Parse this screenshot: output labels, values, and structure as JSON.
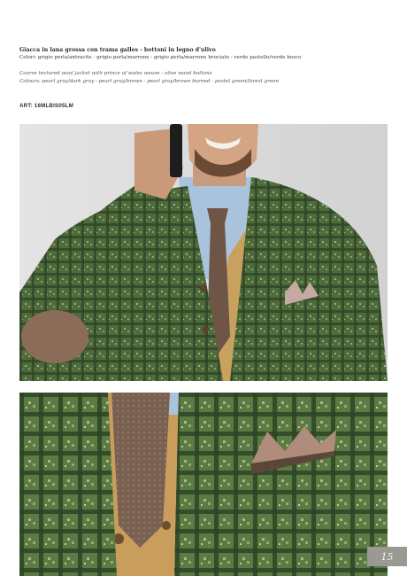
{
  "product": {
    "title_it": "Giacca in lana grossa con trama galles - bottoni in legno d'ulivo",
    "colors_it": "Colori: grigio perla/antracite - grigio perla/marrone - grigio perla/marrone bruciato - verde pastello/verde bosco",
    "title_en": "Coarse textured wool jacket with prince of wales weave - olive wood buttons",
    "colors_en": "Colours: pearl gray/dark gray - pearl gray/brown - pearl gray/brown burned - pastel green/forest green",
    "art": "ART: 16MLBIS05LM"
  },
  "page": {
    "number": "15"
  }
}
